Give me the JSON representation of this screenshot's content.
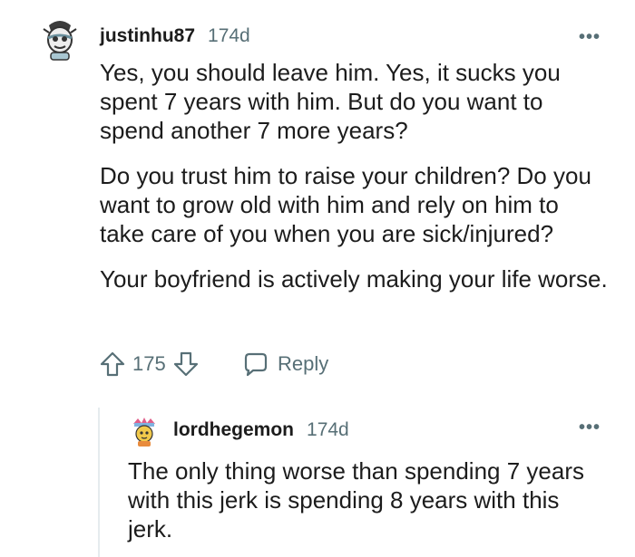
{
  "comments": [
    {
      "username": "justinhu87",
      "age": "174d",
      "paragraphs": [
        "Yes, you should leave him. Yes, it sucks you spent 7 years with him. But do you want to spend another 7 more years?",
        "Do you trust him to raise your children? Do you want to grow old with him and rely on him to take care of you when you are sick/injured?",
        "Your boyfriend is actively making your life worse."
      ],
      "votes": "175",
      "reply_label": "Reply",
      "more_label": "•••"
    },
    {
      "username": "lordhegemon",
      "age": "174d",
      "paragraphs": [
        "The only thing worse than spending 7 years with this jerk is spending 8 years with this jerk."
      ],
      "more_label": "•••"
    }
  ],
  "colors": {
    "text": "#1c1c1c",
    "meta": "#576f76",
    "thread_line": "#e5ebee"
  },
  "icons": [
    "avatar-justinhu87",
    "more-options-icon",
    "upvote-icon",
    "downvote-icon",
    "reply-icon",
    "avatar-lordhegemon"
  ]
}
